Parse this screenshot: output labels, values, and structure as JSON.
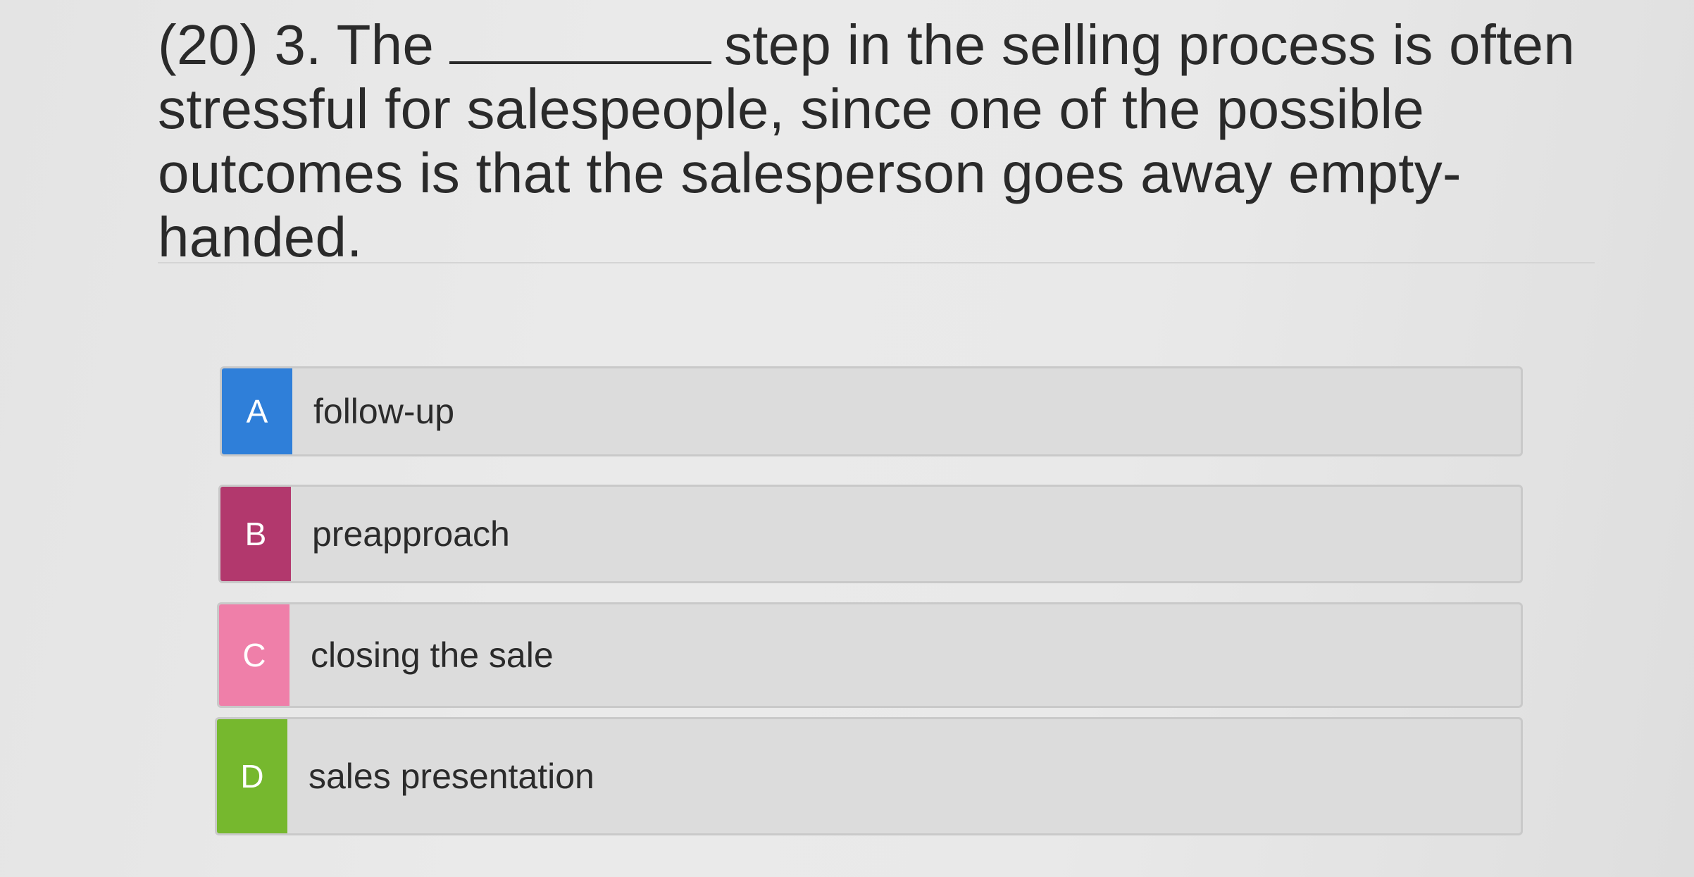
{
  "question": {
    "prefix": "(20) 3. The",
    "suffix": "step in the selling process is often stressful for salespeople, since one of the possible outcomes is that the salesperson goes away empty-handed."
  },
  "options": [
    {
      "letter": "A",
      "text": "follow-up",
      "color": "#2f7fd9"
    },
    {
      "letter": "B",
      "text": "preapproach",
      "color": "#b2386d"
    },
    {
      "letter": "C",
      "text": "closing the sale",
      "color": "#ef7fa9"
    },
    {
      "letter": "D",
      "text": "sales presentation",
      "color": "#76b82e"
    }
  ]
}
